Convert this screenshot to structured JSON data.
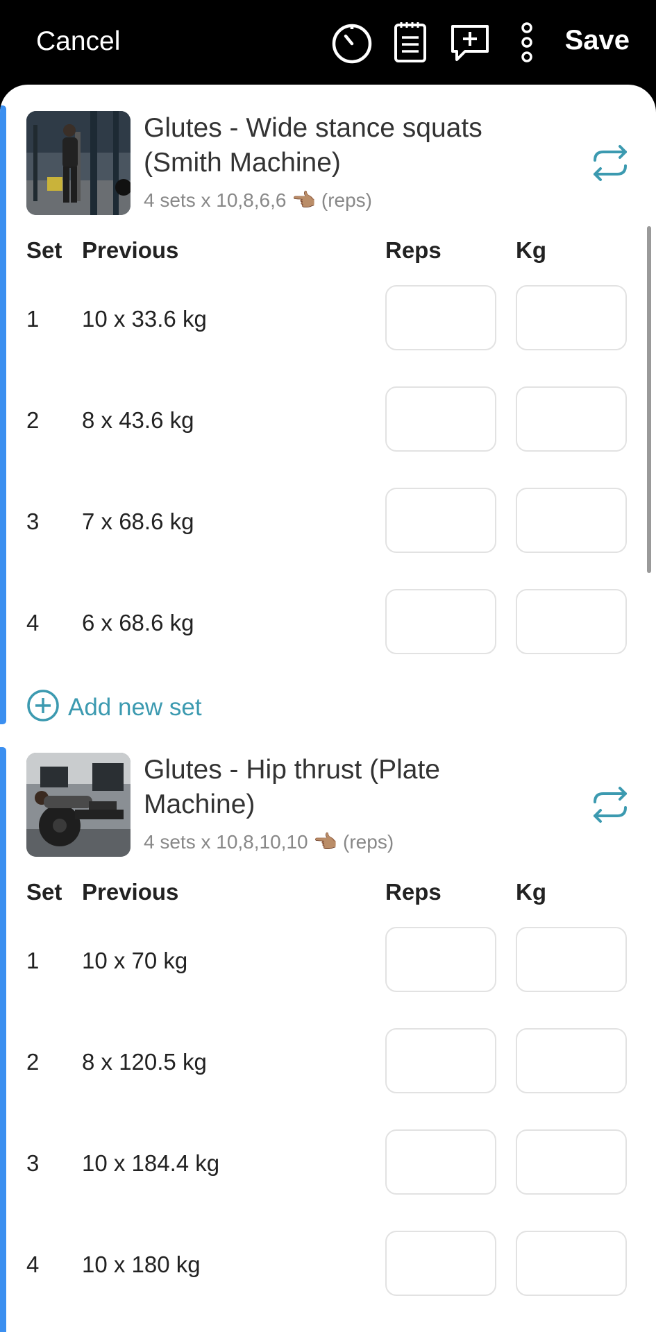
{
  "header": {
    "cancel_label": "Cancel",
    "save_label": "Save",
    "icons": [
      "timer-icon",
      "notepad-icon",
      "add-comment-icon",
      "more-vertical-icon"
    ]
  },
  "colors": {
    "accent": "#3c9ab0",
    "card_bar": "#3b8ff0",
    "header_bg": "#000000"
  },
  "columns": {
    "set": "Set",
    "previous": "Previous",
    "reps": "Reps",
    "kg": "Kg"
  },
  "exercises": [
    {
      "title": "Glutes - Wide stance squats (Smith Machine)",
      "subtitle": "4 sets x 10,8,6,6 👈🏽 (reps)",
      "sets": [
        {
          "num": "1",
          "previous": "10 x 33.6 kg",
          "reps": "",
          "kg": ""
        },
        {
          "num": "2",
          "previous": "8 x 43.6 kg",
          "reps": "",
          "kg": ""
        },
        {
          "num": "3",
          "previous": "7 x 68.6 kg",
          "reps": "",
          "kg": ""
        },
        {
          "num": "4",
          "previous": "6 x 68.6 kg",
          "reps": "",
          "kg": ""
        }
      ],
      "add_set_label": "Add new set"
    },
    {
      "title": "Glutes - Hip thrust (Plate Machine)",
      "subtitle": "4 sets x 10,8,10,10 👈🏽 (reps)",
      "sets": [
        {
          "num": "1",
          "previous": "10 x 70 kg",
          "reps": "",
          "kg": ""
        },
        {
          "num": "2",
          "previous": "8 x 120.5 kg",
          "reps": "",
          "kg": ""
        },
        {
          "num": "3",
          "previous": "10 x 184.4 kg",
          "reps": "",
          "kg": ""
        },
        {
          "num": "4",
          "previous": "10 x 180 kg",
          "reps": "",
          "kg": ""
        }
      ]
    }
  ]
}
